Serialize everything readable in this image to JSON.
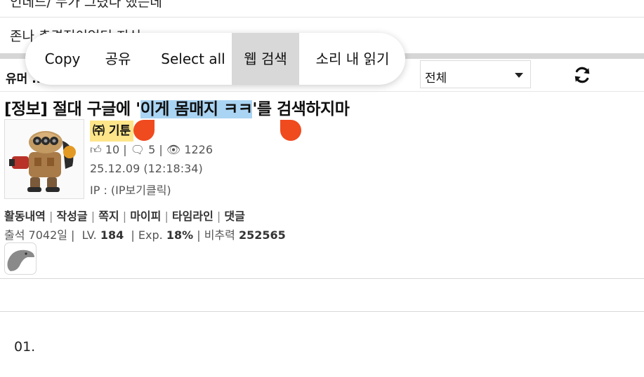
{
  "top_rows": {
    "row1_text": "인데드/ 누가 그렸다 했는데",
    "row2_text": "존나 충격적이었던 지식"
  },
  "context_menu": {
    "items": [
      "Copy",
      "공유",
      "Select all",
      "웹 검색",
      "소리 내 읽기"
    ],
    "active_item": "웹 검색"
  },
  "toolbar": {
    "board_label": "유머 ...",
    "filter_value": "전체",
    "refresh_icon": "refresh-icon"
  },
  "post": {
    "title_before": "[정보] 절대 구글에 '",
    "title_highlight": "이게 몸매지 ㅋㅋ",
    "title_after": "'를 검색하지마",
    "author": "㈜ 기툰",
    "likes": "10",
    "comments": "5",
    "views": "1226",
    "date": "25.12.09 (12:18:34)",
    "ip": "IP : (IP보기클릭)",
    "links": [
      "활동내역",
      "작성글",
      "쪽지",
      "마이피",
      "타임라인",
      "댓글"
    ],
    "attendance": "출석 7042일",
    "level_label": "LV.",
    "level": "184",
    "exp_label": "Exp.",
    "exp": "18%",
    "power_label": "비추력",
    "power": "252565",
    "selection_color": "#aad4f3",
    "handle_color": "#f04a1f"
  },
  "body": {
    "first_line": "01."
  }
}
